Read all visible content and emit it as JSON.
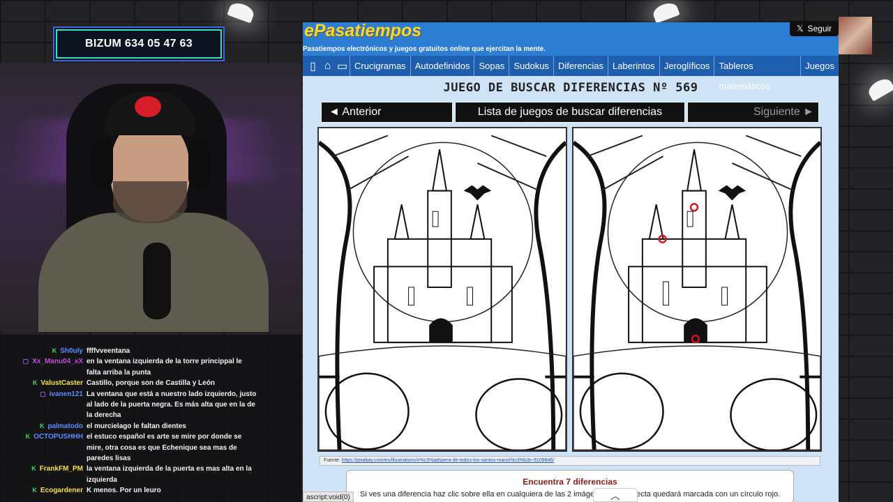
{
  "overlay": {
    "bizum": "BIZUM 634 05 47 63",
    "follow_label": "Seguir"
  },
  "chat": [
    {
      "user": "Sh0uly",
      "color": "#5a8cff",
      "badge": "K",
      "badge_color": "#3fd65b",
      "text": "ffffvveentana"
    },
    {
      "user": "Xx_Manu04_xX",
      "color": "#c04bdc",
      "badge": "▢",
      "badge_color": "#9b5cf6",
      "text": "en la ventana izquierda de la torre princippal le falta arriba la punta"
    },
    {
      "user": "ValustCaster",
      "color": "#f4e04d",
      "badge": "K",
      "badge_color": "#3fd65b",
      "text": "Castillo, porque son de Castilla y León"
    },
    {
      "user": "ivanen121",
      "color": "#5a8cff",
      "badge": "▢",
      "badge_color": "#9b5cf6",
      "text": "La ventana que está a nuestro lado izquierdo, justo al lado de la puerta negra. Es más alta que en la de la derecha"
    },
    {
      "user": "palmatodo",
      "color": "#5a8cff",
      "badge": "K",
      "badge_color": "#3fd65b",
      "text": "el murcielago le faltan dientes"
    },
    {
      "user": "OCTOPUSHHH",
      "color": "#5a8cff",
      "badge": "K",
      "badge_color": "#3fd65b",
      "text": "el estuco español es arte se mire por donde se mire, otra cosa es que Echenique sea mas de paredes lisas"
    },
    {
      "user": "FrankFM_PM",
      "color": "#f4e04d",
      "badge": "K",
      "badge_color": "#3fd65b",
      "text": "la ventana izquierda de la puerta es mas alta en la izquierda"
    },
    {
      "user": "Ecogardener",
      "color": "#f4e04d",
      "badge": "K",
      "badge_color": "#3fd65b",
      "text": "K menos. Por un leuro"
    }
  ],
  "site": {
    "logo": "ePasatiempos",
    "tagline": "Pasatiempos electrónicos y juegos gratuitos online que ejercitan la mente.",
    "nav_icons": [
      "mobile-icon",
      "home-icon",
      "folder-icon"
    ],
    "nav_items": [
      "Crucigramas",
      "Autodefinidos",
      "Sopas",
      "Sudokus",
      "Diferencias",
      "Laberintos",
      "Jeroglíficos",
      "Tableros matemáticos",
      "Juegos"
    ],
    "page_title": "JUEGO DE BUSCAR DIFERENCIAS Nº 569",
    "prev_label": "◄ Anterior",
    "list_label": "Lista de juegos de buscar diferencias",
    "next_label": "Siguiente ►",
    "credit_label": "Fuente:",
    "credit_url": "https://pixabay.com/es/illustrations/v%c3%adspera-de-todos-los-santos-mansi%c3%b3n-9109846/",
    "info_heading": "Encuentra 7 diferencias",
    "info_text": "Si ves una diferencia haz clic sobre ella en cualquiera de las 2 imágenes y la correcta quedará marcada con un círculo rojo.",
    "status_text": "ascript:void(0)",
    "found_marks_color": "#d3141c"
  }
}
